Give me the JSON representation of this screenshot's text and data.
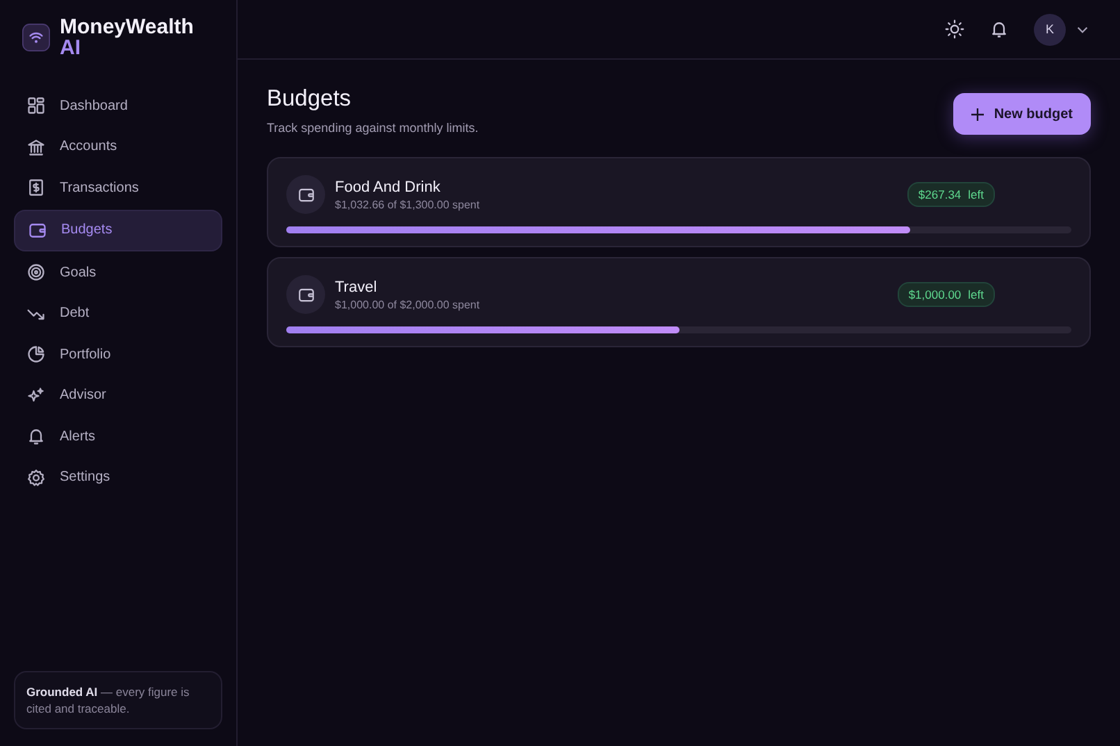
{
  "brand": {
    "name": "MoneyWealth",
    "suffix": "AI"
  },
  "sidebar": {
    "items": [
      {
        "label": "Dashboard",
        "selected": false
      },
      {
        "label": "Accounts",
        "selected": false
      },
      {
        "label": "Transactions",
        "selected": false
      },
      {
        "label": "Budgets",
        "selected": true
      },
      {
        "label": "Goals",
        "selected": false
      },
      {
        "label": "Debt",
        "selected": false
      },
      {
        "label": "Portfolio",
        "selected": false
      },
      {
        "label": "Advisor",
        "selected": false
      },
      {
        "label": "Alerts",
        "selected": false
      },
      {
        "label": "Settings",
        "selected": false
      }
    ],
    "note": "**Grounded AI** — every figure is cited and traceable."
  },
  "header": {
    "avatar": "K"
  },
  "page": {
    "title": "Budgets",
    "subtitle": "Track spending against monthly limits.",
    "button": "New budget"
  },
  "budgets": [
    {
      "name": "Food And Drink",
      "spent": "$1,032.66 of $1,300.00 spent",
      "left_amount": "$267.34",
      "left_label": "left",
      "level": 0.794
    },
    {
      "name": "Travel",
      "spent": "$1,000.00 of $2,000.00 spent",
      "left_amount": "$1,000.00",
      "left_label": "left",
      "level": 0.5
    }
  ]
}
